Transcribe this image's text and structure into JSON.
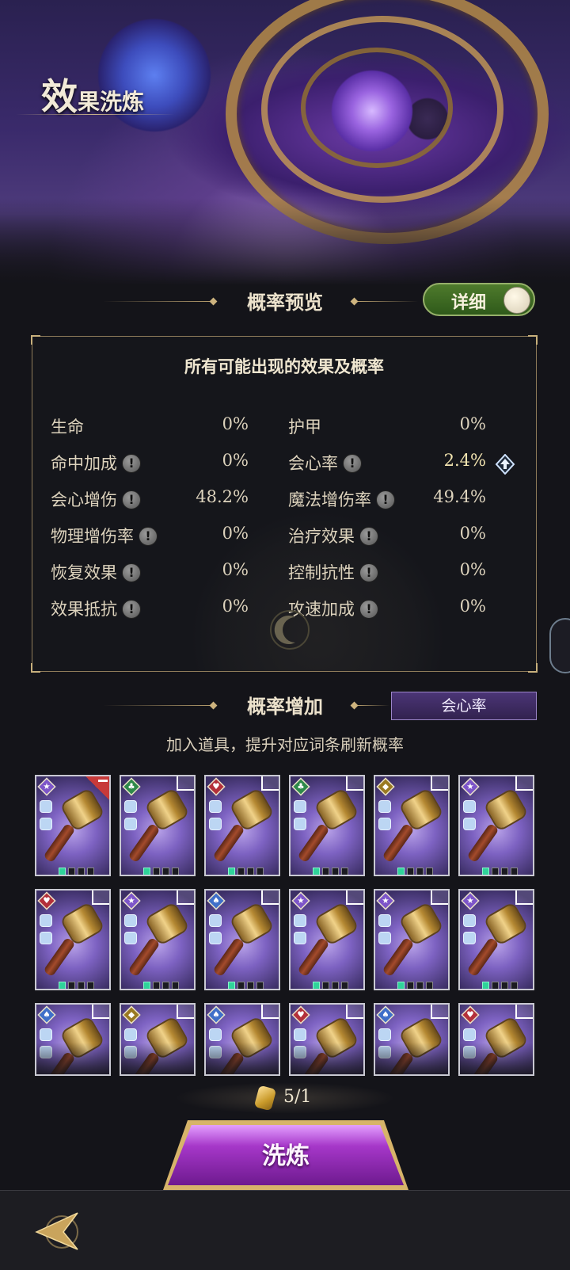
{
  "header": {
    "title_big": "效",
    "title_small": "果洗炼"
  },
  "preview": {
    "title": "概率预览",
    "toggle_label": "详细",
    "subtitle": "所有可能出现的效果及概率",
    "stats": [
      {
        "name": "生命",
        "value": "0%",
        "info": false
      },
      {
        "name": "护甲",
        "value": "0%",
        "info": false
      },
      {
        "name": "命中加成",
        "value": "0%",
        "info": true
      },
      {
        "name": "会心率",
        "value": "2.4%",
        "info": true,
        "boosted": true
      },
      {
        "name": "会心增伤",
        "value": "48.2%",
        "info": true
      },
      {
        "name": "魔法增伤率",
        "value": "49.4%",
        "info": true
      },
      {
        "name": "物理增伤率",
        "value": "0%",
        "info": true
      },
      {
        "name": "治疗效果",
        "value": "0%",
        "info": true
      },
      {
        "name": "恢复效果",
        "value": "0%",
        "info": true
      },
      {
        "name": "控制抗性",
        "value": "0%",
        "info": true
      },
      {
        "name": "效果抵抗",
        "value": "0%",
        "info": true
      },
      {
        "name": "攻速加成",
        "value": "0%",
        "info": true
      }
    ],
    "info_glyph": "!"
  },
  "increase": {
    "title": "概率增加",
    "selected_attr": "会心率",
    "hint": "加入道具，提升对应词条刷新概率"
  },
  "items": [
    {
      "gem": "star",
      "gem_color": "#7d55c9",
      "glyph": "★",
      "selected": true
    },
    {
      "gem": "club",
      "gem_color": "#2e8a4a",
      "glyph": "♣"
    },
    {
      "gem": "heart",
      "gem_color": "#b3303a",
      "glyph": "♥"
    },
    {
      "gem": "club",
      "gem_color": "#2e8a4a",
      "glyph": "♣"
    },
    {
      "gem": "diamond",
      "gem_color": "#9a7a22",
      "glyph": "◆"
    },
    {
      "gem": "star",
      "gem_color": "#7d55c9",
      "glyph": "★"
    },
    {
      "gem": "heart",
      "gem_color": "#b3303a",
      "glyph": "♥"
    },
    {
      "gem": "star",
      "gem_color": "#7d55c9",
      "glyph": "★"
    },
    {
      "gem": "spade",
      "gem_color": "#3f6fc9",
      "glyph": "♠"
    },
    {
      "gem": "star",
      "gem_color": "#7d55c9",
      "glyph": "★"
    },
    {
      "gem": "star",
      "gem_color": "#7d55c9",
      "glyph": "★"
    },
    {
      "gem": "star",
      "gem_color": "#7d55c9",
      "glyph": "★"
    },
    {
      "gem": "spade",
      "gem_color": "#3f6fc9",
      "glyph": "♠"
    },
    {
      "gem": "diamond",
      "gem_color": "#9a7a22",
      "glyph": "◆"
    },
    {
      "gem": "spade",
      "gem_color": "#3f6fc9",
      "glyph": "♠"
    },
    {
      "gem": "heart",
      "gem_color": "#b3303a",
      "glyph": "♥"
    },
    {
      "gem": "spade",
      "gem_color": "#3f6fc9",
      "glyph": "♠"
    },
    {
      "gem": "heart",
      "gem_color": "#b3303a",
      "glyph": "♥"
    }
  ],
  "cost": {
    "count": "5/1"
  },
  "refine_button": {
    "label": "洗炼"
  },
  "colors": {
    "accent_gold": "#c8b07c",
    "toggle_green": "#4e7a2c",
    "button_purple": "#a637c9",
    "boost_value": "#f2e4b0"
  }
}
